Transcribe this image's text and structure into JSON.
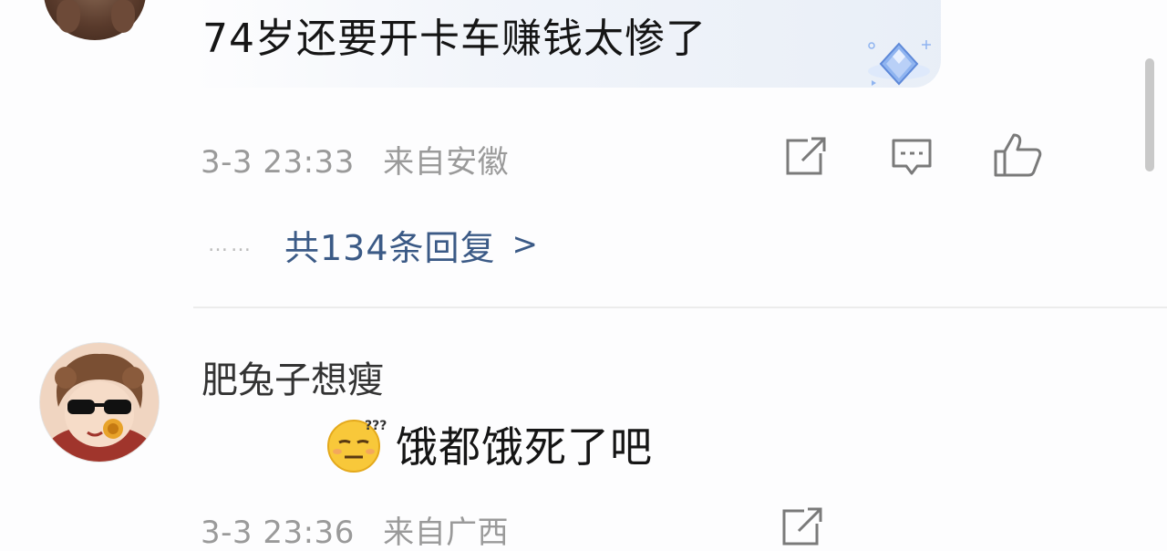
{
  "comment1": {
    "text": "74岁还要开卡车赚钱太惨了",
    "time": "3-3 23:33",
    "location": "来自安徽",
    "badge_icon": "diamond-badge-icon",
    "actions": [
      "share-icon",
      "comment-icon",
      "thumbs-up-icon"
    ],
    "replies": {
      "dots": "……",
      "label": "共134条回复",
      "chevron": ">"
    }
  },
  "comment2": {
    "username": "肥兔子想瘦",
    "emoji_icon": "confused-face-emoji-icon",
    "text": "饿都饿死了吧",
    "time": "3-3 23:36",
    "location": "来自广西",
    "actions": [
      "share-icon"
    ]
  },
  "colors": {
    "meta_gray": "#9a9a9a",
    "link_blue": "#3b5a86",
    "divider": "#ececec",
    "badge_blue": "#7fa8ec"
  }
}
